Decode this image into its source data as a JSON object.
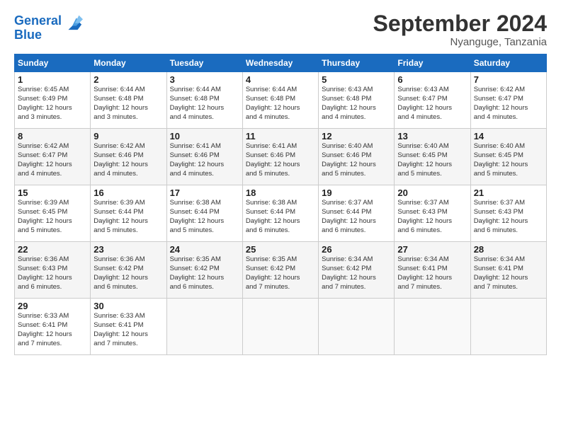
{
  "header": {
    "logo_line1": "General",
    "logo_line2": "Blue",
    "month": "September 2024",
    "location": "Nyanguge, Tanzania"
  },
  "weekdays": [
    "Sunday",
    "Monday",
    "Tuesday",
    "Wednesday",
    "Thursday",
    "Friday",
    "Saturday"
  ],
  "weeks": [
    [
      {
        "day": "1",
        "info": "Sunrise: 6:45 AM\nSunset: 6:49 PM\nDaylight: 12 hours\nand 3 minutes."
      },
      {
        "day": "2",
        "info": "Sunrise: 6:44 AM\nSunset: 6:48 PM\nDaylight: 12 hours\nand 3 minutes."
      },
      {
        "day": "3",
        "info": "Sunrise: 6:44 AM\nSunset: 6:48 PM\nDaylight: 12 hours\nand 4 minutes."
      },
      {
        "day": "4",
        "info": "Sunrise: 6:44 AM\nSunset: 6:48 PM\nDaylight: 12 hours\nand 4 minutes."
      },
      {
        "day": "5",
        "info": "Sunrise: 6:43 AM\nSunset: 6:48 PM\nDaylight: 12 hours\nand 4 minutes."
      },
      {
        "day": "6",
        "info": "Sunrise: 6:43 AM\nSunset: 6:47 PM\nDaylight: 12 hours\nand 4 minutes."
      },
      {
        "day": "7",
        "info": "Sunrise: 6:42 AM\nSunset: 6:47 PM\nDaylight: 12 hours\nand 4 minutes."
      }
    ],
    [
      {
        "day": "8",
        "info": "Sunrise: 6:42 AM\nSunset: 6:47 PM\nDaylight: 12 hours\nand 4 minutes."
      },
      {
        "day": "9",
        "info": "Sunrise: 6:42 AM\nSunset: 6:46 PM\nDaylight: 12 hours\nand 4 minutes."
      },
      {
        "day": "10",
        "info": "Sunrise: 6:41 AM\nSunset: 6:46 PM\nDaylight: 12 hours\nand 4 minutes."
      },
      {
        "day": "11",
        "info": "Sunrise: 6:41 AM\nSunset: 6:46 PM\nDaylight: 12 hours\nand 5 minutes."
      },
      {
        "day": "12",
        "info": "Sunrise: 6:40 AM\nSunset: 6:46 PM\nDaylight: 12 hours\nand 5 minutes."
      },
      {
        "day": "13",
        "info": "Sunrise: 6:40 AM\nSunset: 6:45 PM\nDaylight: 12 hours\nand 5 minutes."
      },
      {
        "day": "14",
        "info": "Sunrise: 6:40 AM\nSunset: 6:45 PM\nDaylight: 12 hours\nand 5 minutes."
      }
    ],
    [
      {
        "day": "15",
        "info": "Sunrise: 6:39 AM\nSunset: 6:45 PM\nDaylight: 12 hours\nand 5 minutes."
      },
      {
        "day": "16",
        "info": "Sunrise: 6:39 AM\nSunset: 6:44 PM\nDaylight: 12 hours\nand 5 minutes."
      },
      {
        "day": "17",
        "info": "Sunrise: 6:38 AM\nSunset: 6:44 PM\nDaylight: 12 hours\nand 5 minutes."
      },
      {
        "day": "18",
        "info": "Sunrise: 6:38 AM\nSunset: 6:44 PM\nDaylight: 12 hours\nand 6 minutes."
      },
      {
        "day": "19",
        "info": "Sunrise: 6:37 AM\nSunset: 6:44 PM\nDaylight: 12 hours\nand 6 minutes."
      },
      {
        "day": "20",
        "info": "Sunrise: 6:37 AM\nSunset: 6:43 PM\nDaylight: 12 hours\nand 6 minutes."
      },
      {
        "day": "21",
        "info": "Sunrise: 6:37 AM\nSunset: 6:43 PM\nDaylight: 12 hours\nand 6 minutes."
      }
    ],
    [
      {
        "day": "22",
        "info": "Sunrise: 6:36 AM\nSunset: 6:43 PM\nDaylight: 12 hours\nand 6 minutes."
      },
      {
        "day": "23",
        "info": "Sunrise: 6:36 AM\nSunset: 6:42 PM\nDaylight: 12 hours\nand 6 minutes."
      },
      {
        "day": "24",
        "info": "Sunrise: 6:35 AM\nSunset: 6:42 PM\nDaylight: 12 hours\nand 6 minutes."
      },
      {
        "day": "25",
        "info": "Sunrise: 6:35 AM\nSunset: 6:42 PM\nDaylight: 12 hours\nand 7 minutes."
      },
      {
        "day": "26",
        "info": "Sunrise: 6:34 AM\nSunset: 6:42 PM\nDaylight: 12 hours\nand 7 minutes."
      },
      {
        "day": "27",
        "info": "Sunrise: 6:34 AM\nSunset: 6:41 PM\nDaylight: 12 hours\nand 7 minutes."
      },
      {
        "day": "28",
        "info": "Sunrise: 6:34 AM\nSunset: 6:41 PM\nDaylight: 12 hours\nand 7 minutes."
      }
    ],
    [
      {
        "day": "29",
        "info": "Sunrise: 6:33 AM\nSunset: 6:41 PM\nDaylight: 12 hours\nand 7 minutes."
      },
      {
        "day": "30",
        "info": "Sunrise: 6:33 AM\nSunset: 6:41 PM\nDaylight: 12 hours\nand 7 minutes."
      },
      {
        "day": "",
        "info": ""
      },
      {
        "day": "",
        "info": ""
      },
      {
        "day": "",
        "info": ""
      },
      {
        "day": "",
        "info": ""
      },
      {
        "day": "",
        "info": ""
      }
    ]
  ]
}
